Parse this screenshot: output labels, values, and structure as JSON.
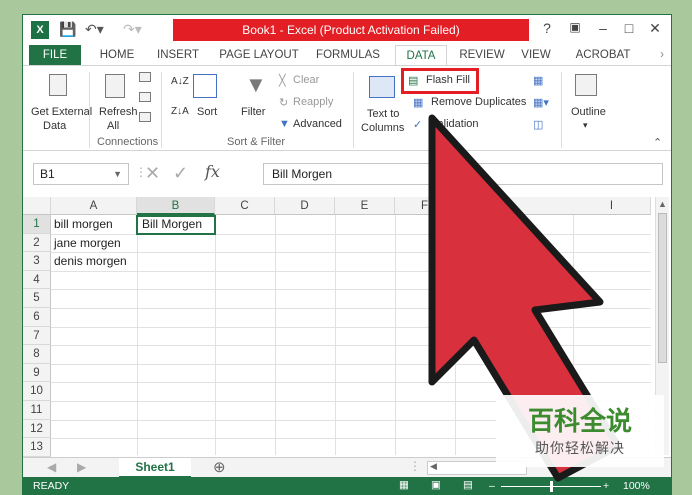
{
  "titlebar": {
    "title": "Book1 -  Excel (Product Activation Failed)",
    "help": "?",
    "icons": [
      "excel-logo-icon",
      "save-icon",
      "undo-icon",
      "redo-icon",
      "ribbon-display-icon",
      "minimize-icon",
      "restore-icon",
      "close-icon"
    ]
  },
  "tabs": {
    "file": "FILE",
    "items": [
      "HOME",
      "INSERT",
      "PAGE LAYOUT",
      "FORMULAS",
      "DATA",
      "REVIEW",
      "VIEW",
      "ACROBAT"
    ],
    "active": "DATA"
  },
  "ribbon": {
    "get_external_1": "Get External",
    "get_external_2": "Data",
    "refresh_1": "Refresh",
    "refresh_2": "All",
    "connections_label": "Connections",
    "sort": "Sort",
    "filter": "Filter",
    "clear": "Clear",
    "reapply": "Reapply",
    "advanced": "Advanced",
    "sort_filter_label": "Sort & Filter",
    "text_to_1": "Text to",
    "text_to_2": "Columns",
    "flash_fill": "Flash Fill",
    "remove_duplicates": "Remove Duplicates",
    "validation": "Validation",
    "outline": "Outline"
  },
  "formula_bar": {
    "name_box": "B1",
    "fx": "fx",
    "value": "Bill Morgen"
  },
  "grid": {
    "columns": [
      "A",
      "B",
      "C",
      "D",
      "E",
      "F",
      "I"
    ],
    "rows": [
      "1",
      "2",
      "3",
      "4",
      "5",
      "6",
      "7",
      "8",
      "9",
      "10",
      "11",
      "12",
      "13"
    ],
    "cells": {
      "A1": "bill morgen",
      "A2": "jane morgen",
      "A3": "denis morgen",
      "B1": "Bill Morgen"
    }
  },
  "sheets": {
    "active": "Sheet1"
  },
  "status": {
    "ready": "READY",
    "zoom": "100%"
  },
  "watermark": {
    "line1": "百科全说",
    "line2": "助你轻松解决"
  },
  "colors": {
    "excel_green": "#217346",
    "title_red": "#e31e24",
    "arrow_red": "#d9303e",
    "background": "#a9c99c"
  }
}
